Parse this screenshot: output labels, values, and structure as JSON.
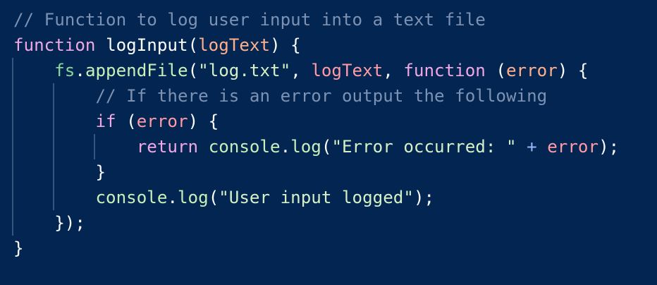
{
  "colors": {
    "background": "#032552",
    "indent_guide": "#35567c",
    "comment": "#7d92b2",
    "keyword": "#f1a8e2",
    "function_name": "#ffffff",
    "param": "#ffb08a",
    "identifier": "#ff9aa6",
    "method": "#c8f0b8",
    "object": "#8ad89b",
    "string": "#d6f0c6",
    "punct": "#ffffff",
    "operator": "#9cb4ff"
  },
  "code": {
    "lines": [
      [
        {
          "text": "// Function to log user input into a text file",
          "kind": "comment"
        }
      ],
      [
        {
          "text": "function",
          "kind": "keyword"
        },
        {
          "text": " ",
          "kind": "punct"
        },
        {
          "text": "logInput",
          "kind": "function_name"
        },
        {
          "text": "(",
          "kind": "punct"
        },
        {
          "text": "logText",
          "kind": "param"
        },
        {
          "text": ") {",
          "kind": "punct"
        }
      ],
      [
        {
          "text": "    ",
          "kind": "punct"
        },
        {
          "text": "fs",
          "kind": "object"
        },
        {
          "text": ".",
          "kind": "punct"
        },
        {
          "text": "appendFile",
          "kind": "method"
        },
        {
          "text": "(",
          "kind": "punct"
        },
        {
          "text": "\"log.txt\"",
          "kind": "string"
        },
        {
          "text": ", ",
          "kind": "punct"
        },
        {
          "text": "logText",
          "kind": "identifier"
        },
        {
          "text": ", ",
          "kind": "punct"
        },
        {
          "text": "function",
          "kind": "keyword"
        },
        {
          "text": " (",
          "kind": "punct"
        },
        {
          "text": "error",
          "kind": "param"
        },
        {
          "text": ") {",
          "kind": "punct"
        }
      ],
      [
        {
          "text": "        ",
          "kind": "punct"
        },
        {
          "text": "// If there is an error output the following",
          "kind": "comment"
        }
      ],
      [
        {
          "text": "        ",
          "kind": "punct"
        },
        {
          "text": "if",
          "kind": "keyword"
        },
        {
          "text": " (",
          "kind": "punct"
        },
        {
          "text": "error",
          "kind": "identifier"
        },
        {
          "text": ") {",
          "kind": "punct"
        }
      ],
      [
        {
          "text": "            ",
          "kind": "punct"
        },
        {
          "text": "return",
          "kind": "keyword"
        },
        {
          "text": " ",
          "kind": "punct"
        },
        {
          "text": "console",
          "kind": "method"
        },
        {
          "text": ".",
          "kind": "punct"
        },
        {
          "text": "log",
          "kind": "method"
        },
        {
          "text": "(",
          "kind": "punct"
        },
        {
          "text": "\"Error occurred: \"",
          "kind": "string"
        },
        {
          "text": " ",
          "kind": "punct"
        },
        {
          "text": "+",
          "kind": "operator"
        },
        {
          "text": " ",
          "kind": "punct"
        },
        {
          "text": "error",
          "kind": "identifier"
        },
        {
          "text": ");",
          "kind": "punct"
        }
      ],
      [
        {
          "text": "        }",
          "kind": "punct"
        }
      ],
      [
        {
          "text": "        ",
          "kind": "punct"
        },
        {
          "text": "console",
          "kind": "method"
        },
        {
          "text": ".",
          "kind": "punct"
        },
        {
          "text": "log",
          "kind": "method"
        },
        {
          "text": "(",
          "kind": "punct"
        },
        {
          "text": "\"User input logged\"",
          "kind": "string"
        },
        {
          "text": ");",
          "kind": "punct"
        }
      ],
      [
        {
          "text": "    });",
          "kind": "punct"
        }
      ],
      [
        {
          "text": "}",
          "kind": "punct"
        }
      ]
    ]
  }
}
